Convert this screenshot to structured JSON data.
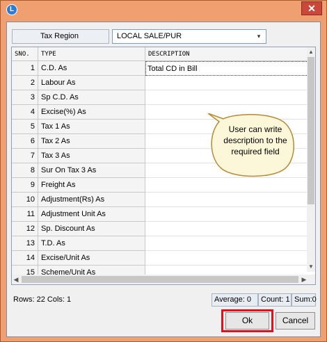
{
  "window": {
    "icon_letter": "L",
    "close_glyph": "✕"
  },
  "tax_region": {
    "label": "Tax Region",
    "value": "LOCAL SALE/PUR",
    "arrow_glyph": "▾"
  },
  "grid": {
    "columns": [
      "SNO.",
      "TYPE",
      "DESCRIPTION"
    ],
    "rows": [
      {
        "sno": "1",
        "type": "C.D. As",
        "description": "Total CD in Bill"
      },
      {
        "sno": "2",
        "type": "Labour As",
        "description": ""
      },
      {
        "sno": "3",
        "type": "Sp C.D. As",
        "description": ""
      },
      {
        "sno": "4",
        "type": "Excise(%) As",
        "description": ""
      },
      {
        "sno": "5",
        "type": "Tax 1 As",
        "description": ""
      },
      {
        "sno": "6",
        "type": "Tax 2 As",
        "description": ""
      },
      {
        "sno": "7",
        "type": "Tax 3 As",
        "description": ""
      },
      {
        "sno": "8",
        "type": "Sur On Tax 3 As",
        "description": ""
      },
      {
        "sno": "9",
        "type": "Freight As",
        "description": ""
      },
      {
        "sno": "10",
        "type": "Adjustment(Rs) As",
        "description": ""
      },
      {
        "sno": "11",
        "type": "Adjustment Unit As",
        "description": ""
      },
      {
        "sno": "12",
        "type": "Sp. Discount As",
        "description": ""
      },
      {
        "sno": "13",
        "type": "T.D. As",
        "description": ""
      },
      {
        "sno": "14",
        "type": "Excise/Unit As",
        "description": ""
      },
      {
        "sno": "15",
        "type": "Scheme/Unit As",
        "description": ""
      }
    ],
    "scroll_up": "▲",
    "scroll_down": "▼",
    "scroll_left": "◀",
    "scroll_right": "▶"
  },
  "callout": {
    "text": "User can write description to the required field",
    "fill": "#fcf7d9",
    "stroke": "#b58a3a"
  },
  "status": {
    "rows_cols": "Rows: 22  Cols: 1",
    "average": "Average: 0",
    "count": "Count: 1",
    "sum": "Sum:0"
  },
  "buttons": {
    "ok": "Ok",
    "cancel": "Cancel"
  },
  "colors": {
    "title_bar": "#f0a070",
    "highlight": "#e0101d"
  }
}
